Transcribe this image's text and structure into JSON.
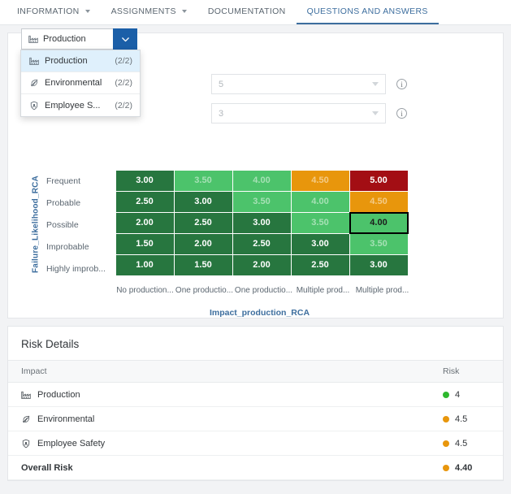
{
  "tabs": [
    {
      "label": "INFORMATION",
      "caret": true,
      "active": false,
      "icon": "chevron-down-icon"
    },
    {
      "label": "ASSIGNMENTS",
      "caret": true,
      "active": false,
      "icon": "chevron-down-icon"
    },
    {
      "label": "DOCUMENTATION",
      "caret": false,
      "active": false,
      "icon": ""
    },
    {
      "label": "QUESTIONS AND ANSWERS",
      "caret": false,
      "active": true,
      "icon": ""
    }
  ],
  "selector": {
    "value": "Production",
    "icon": "factory-icon",
    "toggle_icon": "chevron-down-icon",
    "open": true,
    "options": [
      {
        "label": "Production",
        "count": "(2/2)",
        "icon": "factory-icon",
        "selected": true
      },
      {
        "label": "Environmental",
        "count": "(2/2)",
        "icon": "leaf-icon",
        "selected": false
      },
      {
        "label": "Employee S...",
        "count": "(2/2)",
        "icon": "shield-icon",
        "selected": false
      }
    ]
  },
  "fields": [
    {
      "value": "5",
      "info_icon": "info-icon",
      "caret_icon": "chevron-down-icon"
    },
    {
      "value": "3",
      "info_icon": "info-icon",
      "caret_icon": "chevron-down-icon"
    }
  ],
  "chart_data": {
    "type": "heatmap",
    "title": "",
    "ylabel": "Failure_Likelihood_RCA",
    "xlabel": "Impact_production_RCA",
    "row_labels": [
      "Frequent",
      "Probable",
      "Possible",
      "Improbable",
      "Highly improb..."
    ],
    "col_labels": [
      "No production...",
      "One productio...",
      "One productio...",
      "Multiple prod...",
      "Multiple prod..."
    ],
    "values": [
      [
        3.0,
        3.5,
        4.0,
        4.5,
        5.0
      ],
      [
        2.5,
        3.0,
        3.5,
        4.0,
        4.5
      ],
      [
        2.0,
        2.5,
        3.0,
        3.5,
        4.0
      ],
      [
        1.5,
        2.0,
        2.5,
        3.0,
        3.5
      ],
      [
        1.0,
        1.5,
        2.0,
        2.5,
        3.0
      ]
    ],
    "cell_text": [
      [
        "3.00",
        "3.50",
        "4.00",
        "4.50",
        "5.00"
      ],
      [
        "2.50",
        "3.00",
        "3.50",
        "4.00",
        "4.50"
      ],
      [
        "2.00",
        "2.50",
        "3.00",
        "3.50",
        "4.00"
      ],
      [
        "1.50",
        "2.00",
        "2.50",
        "3.00",
        "3.50"
      ],
      [
        "1.00",
        "1.50",
        "2.00",
        "2.50",
        "3.00"
      ]
    ],
    "cell_colors": [
      [
        "#27763f",
        "#4cc36b",
        "#4cc36b",
        "#e8960c",
        "#a30e14"
      ],
      [
        "#27763f",
        "#27763f",
        "#4cc36b",
        "#4cc36b",
        "#e8960c"
      ],
      [
        "#27763f",
        "#27763f",
        "#27763f",
        "#4cc36b",
        "#4cc36b"
      ],
      [
        "#27763f",
        "#27763f",
        "#27763f",
        "#27763f",
        "#4cc36b"
      ],
      [
        "#27763f",
        "#27763f",
        "#27763f",
        "#27763f",
        "#27763f"
      ]
    ],
    "dim_flags": [
      [
        false,
        true,
        true,
        true,
        false
      ],
      [
        false,
        false,
        true,
        true,
        true
      ],
      [
        false,
        false,
        false,
        true,
        false
      ],
      [
        false,
        false,
        false,
        false,
        true
      ],
      [
        false,
        false,
        false,
        false,
        false
      ]
    ],
    "selected_cell": {
      "row": 2,
      "col": 4,
      "value": "4.00"
    },
    "grid": false,
    "legend": "none"
  },
  "risk_details": {
    "title": "Risk Details",
    "columns": {
      "impact": "Impact",
      "risk": "Risk"
    },
    "rows": [
      {
        "label": "Production",
        "risk": "4",
        "color": "#2eb82e",
        "icon": "factory-icon",
        "total": false
      },
      {
        "label": "Environmental",
        "risk": "4.5",
        "color": "#e8960c",
        "icon": "leaf-icon",
        "total": false
      },
      {
        "label": "Employee Safety",
        "risk": "4.5",
        "color": "#e8960c",
        "icon": "shield-icon",
        "total": false
      },
      {
        "label": "Overall Risk",
        "risk": "4.40",
        "color": "#e8960c",
        "icon": "",
        "total": true
      }
    ]
  },
  "colors": {
    "accent": "#3d6e9e",
    "button_blue": "#1b5fa8",
    "dark_green": "#27763f",
    "light_green": "#4cc36b",
    "orange": "#e8960c",
    "red": "#a30e14"
  }
}
